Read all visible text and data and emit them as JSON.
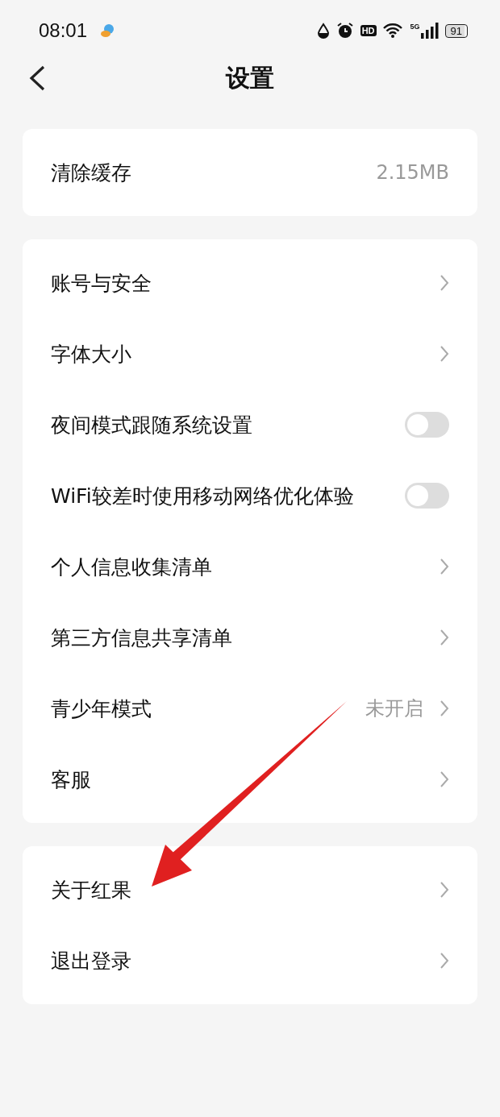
{
  "status_bar": {
    "time": "08:01",
    "hd": "HD",
    "network": "5G",
    "battery": "91"
  },
  "header": {
    "title": "设置"
  },
  "groups": [
    {
      "rows": [
        {
          "kind": "value",
          "label": "清除缓存",
          "value": "2.15MB"
        }
      ]
    },
    {
      "rows": [
        {
          "kind": "link",
          "label": "账号与安全"
        },
        {
          "kind": "link",
          "label": "字体大小"
        },
        {
          "kind": "toggle",
          "label": "夜间模式跟随系统设置",
          "on": false
        },
        {
          "kind": "toggle",
          "label": "WiFi较差时使用移动网络优化体验",
          "on": false
        },
        {
          "kind": "link",
          "label": "个人信息收集清单"
        },
        {
          "kind": "link",
          "label": "第三方信息共享清单"
        },
        {
          "kind": "link",
          "label": "青少年模式",
          "value": "未开启"
        },
        {
          "kind": "link",
          "label": "客服"
        }
      ]
    },
    {
      "rows": [
        {
          "kind": "link",
          "label": "关于红果"
        },
        {
          "kind": "link",
          "label": "退出登录"
        }
      ]
    }
  ],
  "annotation": {
    "kind": "arrow"
  }
}
